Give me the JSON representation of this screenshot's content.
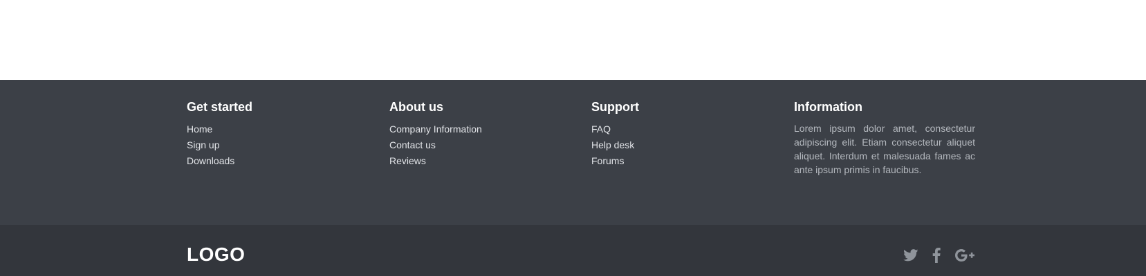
{
  "footer": {
    "columns": [
      {
        "title": "Get started",
        "links": [
          "Home",
          "Sign up",
          "Downloads"
        ]
      },
      {
        "title": "About us",
        "links": [
          "Company Information",
          "Contact us",
          "Reviews"
        ]
      },
      {
        "title": "Support",
        "links": [
          "FAQ",
          "Help desk",
          "Forums"
        ]
      }
    ],
    "information": {
      "title": "Information",
      "text": "Lorem ipsum dolor amet, consectetur adipiscing elit. Etiam consectetur aliquet aliquet. Interdum et malesuada fames ac ante ipsum primis in faucibus."
    }
  },
  "bottom_bar": {
    "logo": "LOGO",
    "social_icons": [
      "twitter-icon",
      "facebook-icon",
      "google-plus-icon"
    ],
    "icon_color": "#8f949b"
  },
  "colors": {
    "footer_bg": "#3c4047",
    "bottom_bar_bg": "#33363c",
    "heading": "#ffffff",
    "link": "#e2e4e8",
    "body_text": "#b4b8be"
  }
}
